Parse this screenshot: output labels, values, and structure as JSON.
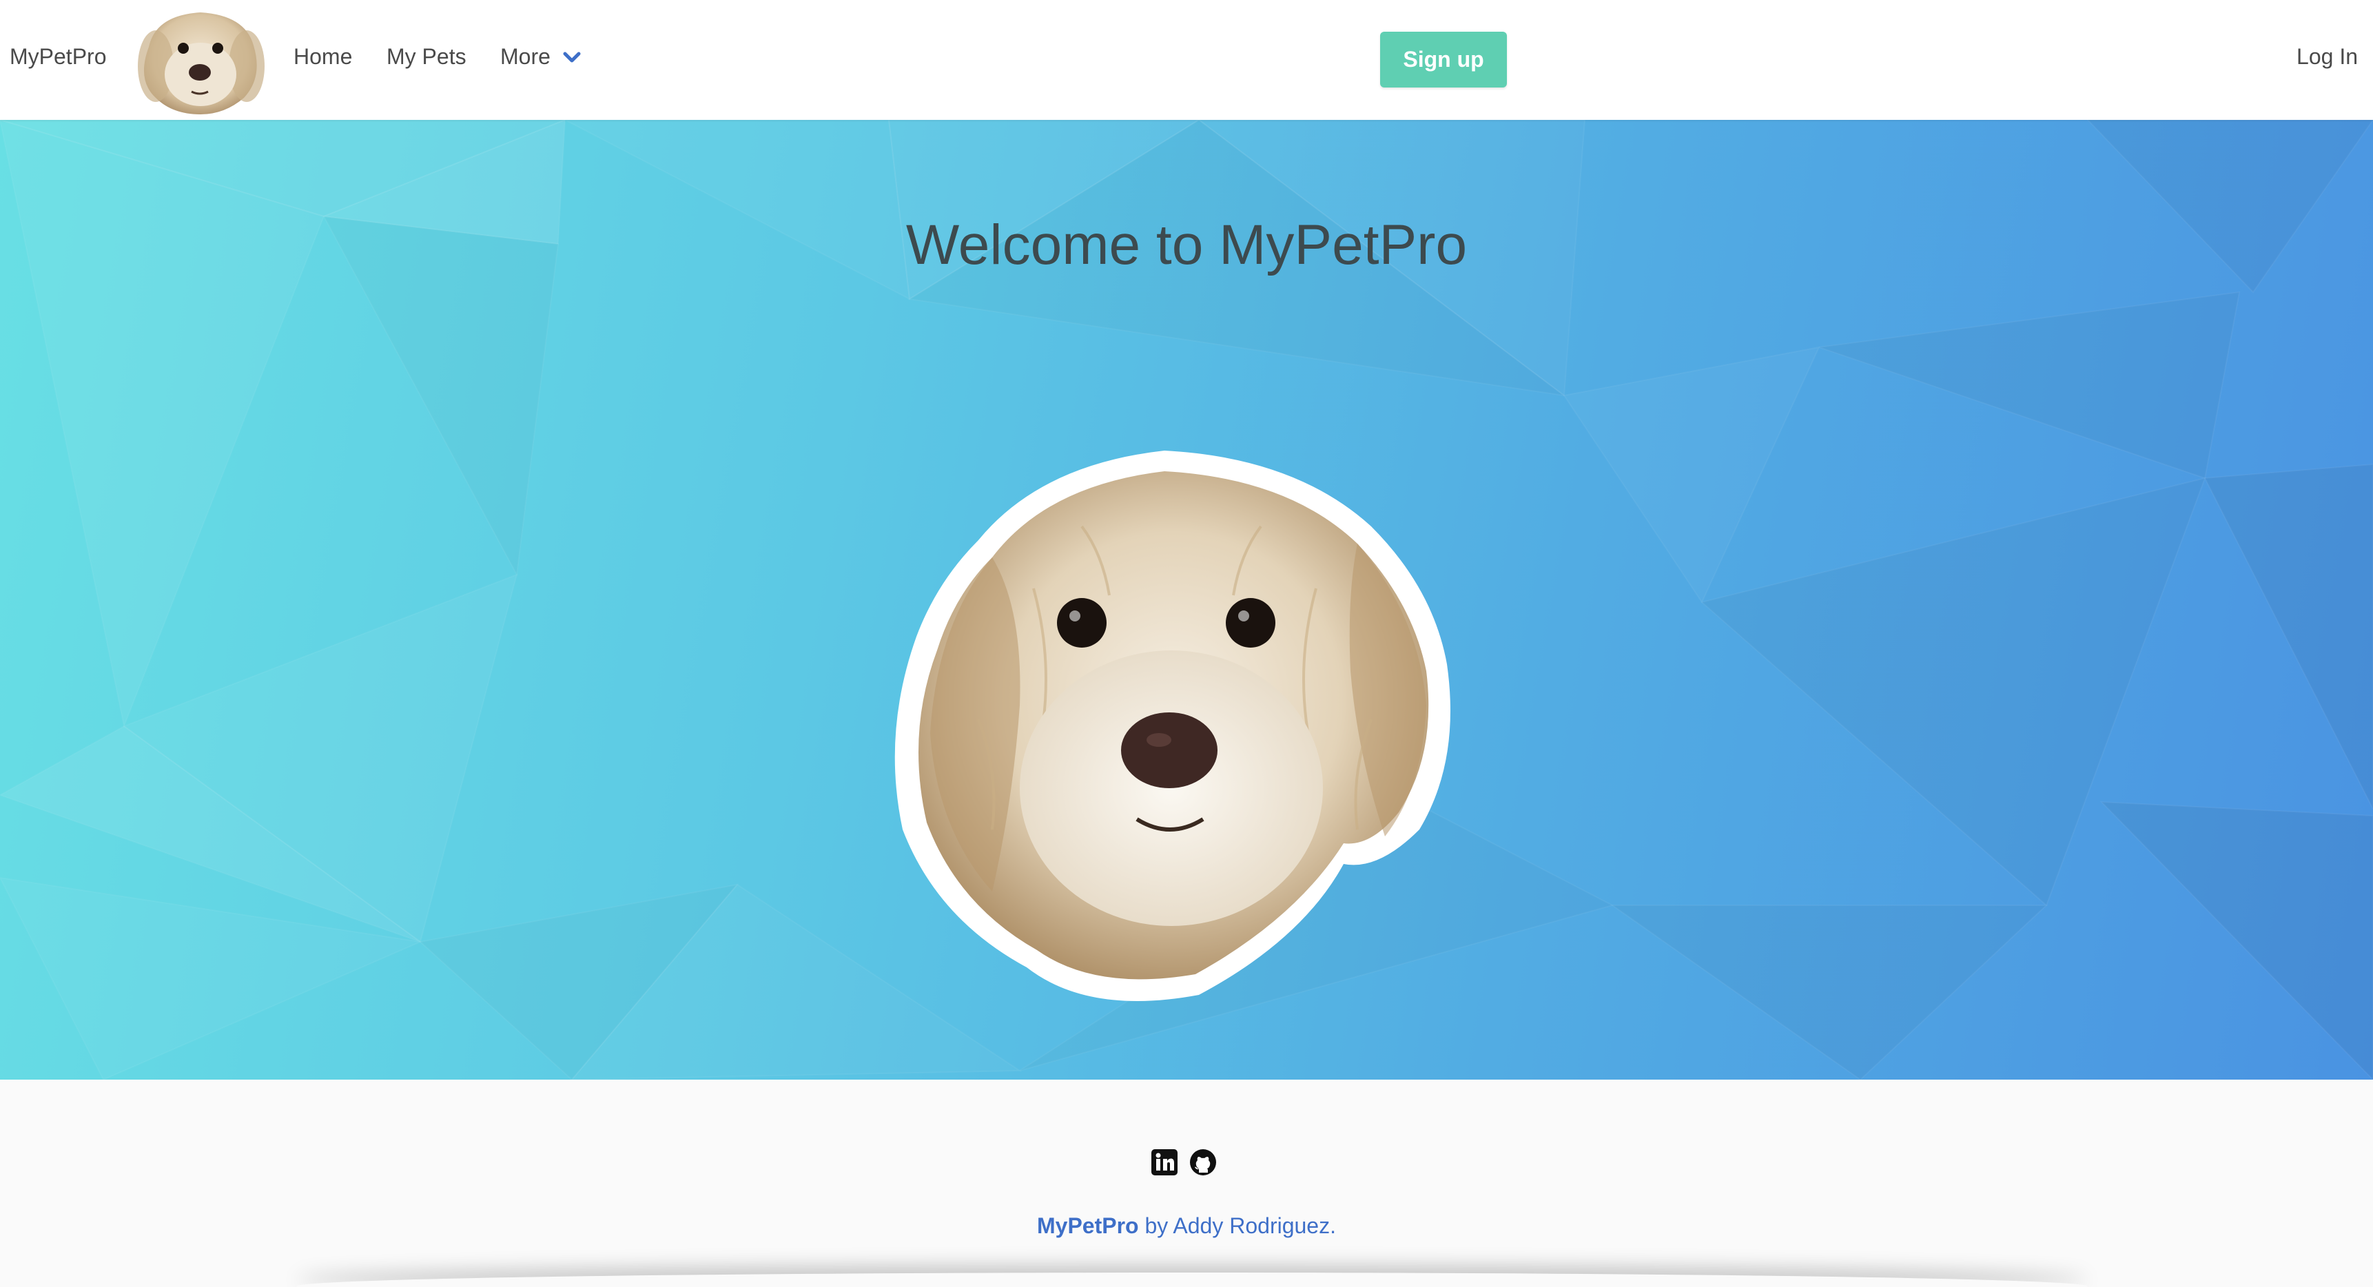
{
  "navbar": {
    "brand": "MyPetPro",
    "links": [
      "Home",
      "My Pets",
      "More"
    ],
    "signup_label": "Sign up",
    "login_label": "Log In"
  },
  "hero": {
    "title": "Welcome to MyPetPro"
  },
  "footer": {
    "icons": [
      "linkedin-icon",
      "github-icon"
    ],
    "brand": "MyPetPro",
    "by": " by ",
    "author": "Addy Rodriguez",
    "suffix": "."
  },
  "colors": {
    "accent": "#5fcfb2",
    "link": "#3e6fc8",
    "hero_left": "#68dfe4",
    "hero_right": "#4a93e2"
  }
}
